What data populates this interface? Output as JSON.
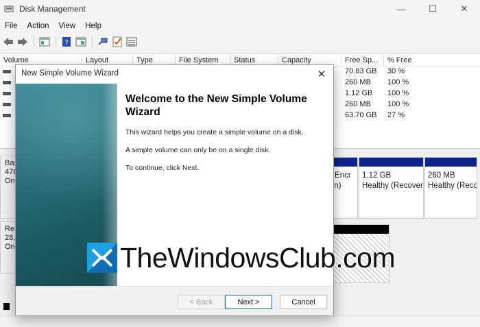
{
  "window": {
    "title": "Disk Management",
    "minimize": "—",
    "maximize": "☐",
    "close": "✕"
  },
  "menu": [
    "File",
    "Action",
    "View",
    "Help"
  ],
  "volume_table": {
    "columns": [
      "Volume",
      "Layout",
      "Type",
      "File System",
      "Status",
      "Capacity",
      "Free Sp...",
      "% Free"
    ],
    "rows": [
      {
        "free": "70.83 GB",
        "pct": "30 %"
      },
      {
        "free": "260 MB",
        "pct": "100 %"
      },
      {
        "free": "1.12 GB",
        "pct": "100 %"
      },
      {
        "free": "260 MB",
        "pct": "100 %"
      },
      {
        "free": "63.70 GB",
        "pct": "27 %"
      }
    ]
  },
  "disks": [
    {
      "label_lines": [
        "Bas",
        "476",
        "On"
      ]
    },
    {
      "label_lines": [
        "Re",
        "28,",
        "On"
      ]
    }
  ],
  "partitions": {
    "p1": {
      "line1": "r Encr",
      "line2": "on)"
    },
    "p2": {
      "line1": "1.12 GB",
      "line2": "Healthy (Recover"
    },
    "p3": {
      "line1": "260 MB",
      "line2": "Healthy (Recove"
    }
  },
  "wizard": {
    "title": "New Simple Volume Wizard",
    "close": "✕",
    "heading": "Welcome to the New Simple Volume Wizard",
    "para1": "This wizard helps you create a simple volume on a disk.",
    "para2": "A simple volume can only be on a single disk.",
    "para3": "To continue, click Next.",
    "back_label": "< Back",
    "next_label": "Next >",
    "cancel_label": "Cancel"
  },
  "watermark": {
    "text": "TheWindowsClub.com"
  },
  "colors": {
    "partition_cap": "#10238c",
    "accent": "#0067c0",
    "wizard_panel": "#2a6f78"
  }
}
